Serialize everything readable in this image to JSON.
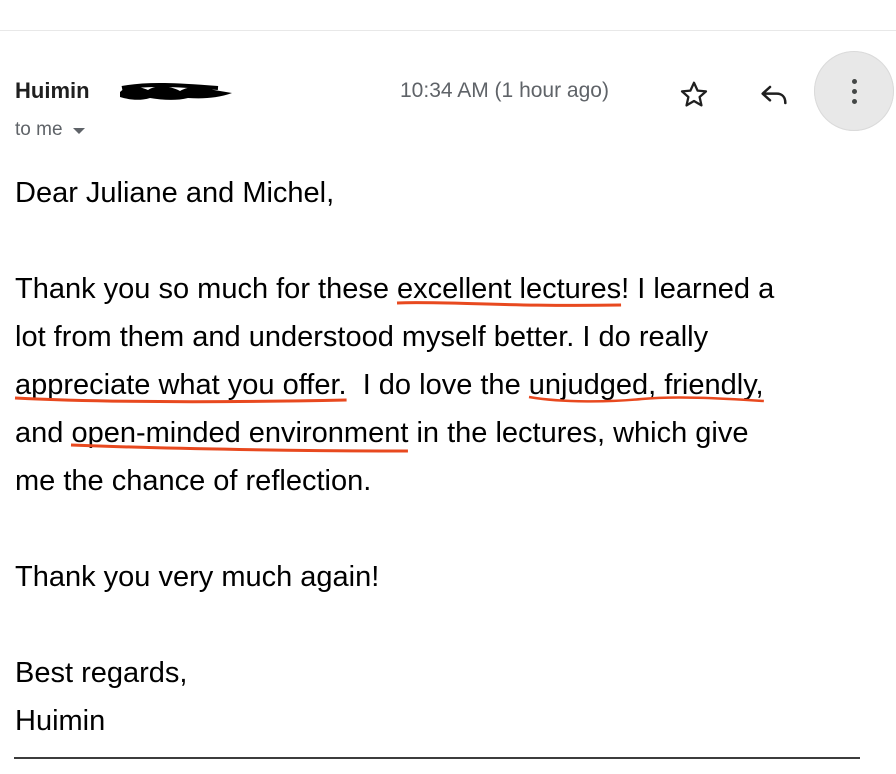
{
  "email": {
    "sender_name": "Huimin",
    "recipient_label": "to me",
    "timestamp": "10:34 AM (1 hour ago)"
  },
  "icons": {
    "star": "star-icon",
    "reply": "reply-icon",
    "more": "more-vertical-icon",
    "expand": "chevron-down-icon"
  },
  "body": {
    "greeting": "Dear Juliane and Michel,",
    "p1": {
      "l1_a": "Thank you so much for these ",
      "l1_u": "excellent lectures",
      "l1_b": "! I learned a",
      "l2": "lot from them and understood myself better. I do really",
      "l3_u1": "appreciate what you offer.",
      "l3_b": "  I do love the ",
      "l3_u2": "unjudged, friendly,",
      "l4_a": "and ",
      "l4_u": "open-minded environment",
      "l4_b": " in the lectures, which give",
      "l5": "me the chance of reflection."
    },
    "thanks": "Thank you very much again!",
    "closing": "Best regards,",
    "signature": "Huimin"
  },
  "colors": {
    "annotation": "#e8491f",
    "meta_text": "#5f6368",
    "more_button_bg": "#e8e8e8"
  }
}
